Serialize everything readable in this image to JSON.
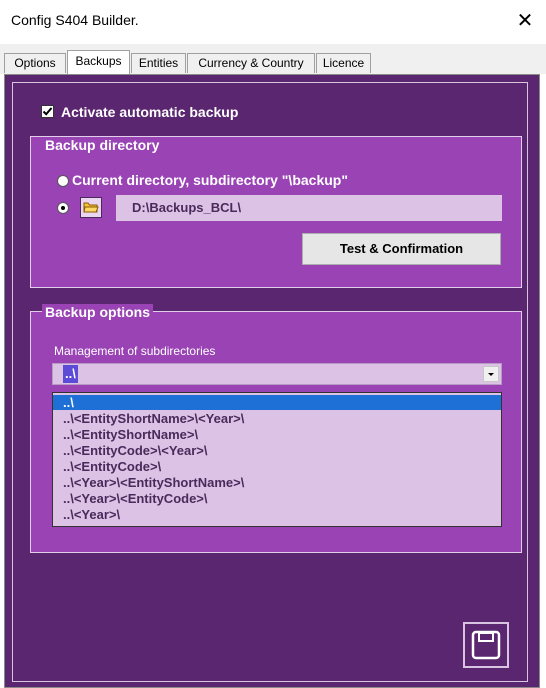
{
  "window": {
    "title": "Config S404 Builder.",
    "close_glyph": "✕"
  },
  "tabs": [
    {
      "label": "Options",
      "active": false
    },
    {
      "label": "Backups",
      "active": true
    },
    {
      "label": "Entities",
      "active": false
    },
    {
      "label": "Currency & Country",
      "active": false
    },
    {
      "label": "Licence",
      "active": false
    }
  ],
  "backup": {
    "activate_label": "Activate automatic backup",
    "activate_checked": true
  },
  "directory": {
    "group_title": "Backup directory",
    "option_current_label": "Current directory, subdirectory \"\\backup\"",
    "custom_path": "D:\\Backups_BCL\\",
    "selected": "custom",
    "test_button_label": "Test & Confirmation"
  },
  "options": {
    "group_title": "Backup options",
    "subdir_label": "Management of subdirectories",
    "subdir_selected": "..\\",
    "subdir_options": [
      "..\\",
      "..\\<EntityShortName>\\<Year>\\",
      "..\\<EntityShortName>\\",
      "..\\<EntityCode>\\<Year>\\",
      "..\\<EntityCode>\\",
      "..\\<Year>\\<EntityShortName>\\",
      "..\\<Year>\\<EntityCode>\\",
      "..\\<Year>\\"
    ]
  },
  "colors": {
    "panel_bg": "#5b2670",
    "group_bg": "#9a43b5",
    "field_bg": "#dcc3e6",
    "selection": "#1e6fd6"
  },
  "icons": {
    "close": "close-icon",
    "folder": "folder-icon",
    "dropdown": "chevron-down-icon",
    "save": "floppy-disk-icon"
  }
}
